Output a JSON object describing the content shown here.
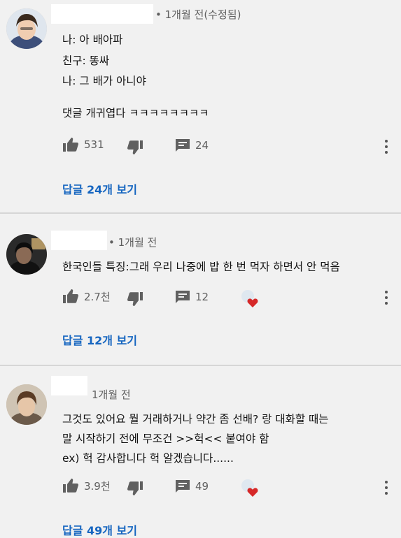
{
  "comments": [
    {
      "meta": "• 1개월 전(수정됨)",
      "lines": [
        "나: 아 배아파",
        "친구: 똥싸",
        "나: 그 배가 아니야",
        "댓글 개귀엽다 ㅋㅋㅋㅋㅋㅋㅋㅋ"
      ],
      "likes": "531",
      "replies": "24",
      "reply_link": "답글 24개 보기"
    },
    {
      "meta": "• 1개월 전",
      "lines": [
        "한국인들 특징:그래 우리 나중에 밥 한 번 먹자 하면서 안 먹음"
      ],
      "likes": "2.7천",
      "replies": "12",
      "reply_link": "답글 12개 보기"
    },
    {
      "meta": "1개월 전",
      "lines": [
        "그것도 있어요 뭘 거래하거나 약간 좀 선배? 랑 대화할 때는",
        "말 시작하기 전에 무조건 >>헉<< 붙여야 함",
        "ex) 헉 감사합니다 헉 알겠습니다......"
      ],
      "likes": "3.9천",
      "replies": "49",
      "reply_link": "답글 49개 보기"
    }
  ],
  "colors": {
    "background": "#f1f1f1",
    "reply_link": "#1565c0",
    "heart": "#d62828",
    "divider": "#d6d6d6"
  },
  "icons": {
    "like": "thumbs-up-icon",
    "dislike": "thumbs-down-icon",
    "reply": "comment-icon",
    "more": "more-vertical-icon",
    "creator_heart": "creator-heart-icon"
  }
}
